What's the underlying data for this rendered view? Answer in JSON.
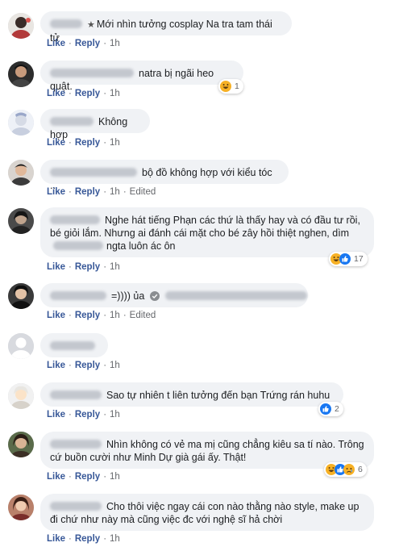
{
  "actions": {
    "like": "Like",
    "reply": "Reply",
    "edited": "Edited",
    "sep": "·"
  },
  "comments": [
    {
      "text": "Mới nhìn tưởng cosplay Na tra tam thái tử",
      "time": "1h"
    },
    {
      "text": "natra bị ngãi heo quật.",
      "time": "1h",
      "reaction_count": "1"
    },
    {
      "text": "Không hợp",
      "time": "1h"
    },
    {
      "text": "bộ đồ không hợp với kiểu tóc ..",
      "time": "1h"
    },
    {
      "text_pre": "Nghe hát tiếng Phạn các thứ là thấy hay và có đầu tư rồi, bé giỏi lắm. Nhưng ai đánh cái mặt cho bé zây hồi thiệt nghen, dìm",
      "text_post": "ngta luôn ác ôn",
      "time": "1h",
      "reaction_count": "17"
    },
    {
      "text": "=)))) ủa",
      "time": "1h"
    },
    {
      "time": "1h"
    },
    {
      "text": "Sao tự nhiên t liên tưởng đến bạn Trứng rán huhu",
      "time": "1h",
      "reaction_count": "2"
    },
    {
      "text": "Nhìn không có vẻ ma mị cũng chẳng kiêu sa tí nào. Trông cứ buồn cười như Minh Dự già gái ấy. Thật!",
      "time": "1h",
      "reaction_count": "6"
    },
    {
      "text": "Cho thôi việc ngay cái con nào thằng nào style, make up đi chứ như này mà cũng việc đc với nghệ sĩ hả chời",
      "time": "1h"
    }
  ],
  "icons": {
    "reactions": [
      "haha-icon",
      "like-icon",
      "sad-icon"
    ],
    "verified": "check-circle-icon",
    "star": "star-icon"
  },
  "colors": {
    "bubble": "#f0f2f5",
    "link": "#385898",
    "meta": "#65676b",
    "like_blue": "#1877f2",
    "haha_yellow": "#f7b125"
  }
}
